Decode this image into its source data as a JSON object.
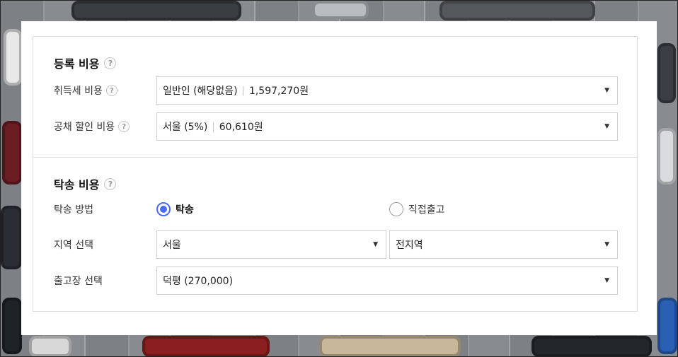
{
  "registration": {
    "title": "등록 비용",
    "acquisition_tax": {
      "label": "취득세 비용",
      "selected": "일반인 (해당없음)",
      "amount": "1,597,270원"
    },
    "bond_discount": {
      "label": "공채 할인 비용",
      "selected": "서울 (5%)",
      "amount": "60,610원"
    }
  },
  "consignment": {
    "title": "탁송 비용",
    "method": {
      "label": "탁송 방법",
      "options": [
        {
          "label": "탁송",
          "checked": true
        },
        {
          "label": "직접출고",
          "checked": false
        }
      ]
    },
    "region": {
      "label": "지역 선택",
      "city": "서울",
      "district": "전지역"
    },
    "release_center": {
      "label": "출고장 선택",
      "selected": "덕평 (270,000)"
    }
  },
  "icons": {
    "help": "?",
    "caret": "▼"
  },
  "colors": {
    "accent": "#4a6cf7",
    "border": "#cfcfcf"
  }
}
